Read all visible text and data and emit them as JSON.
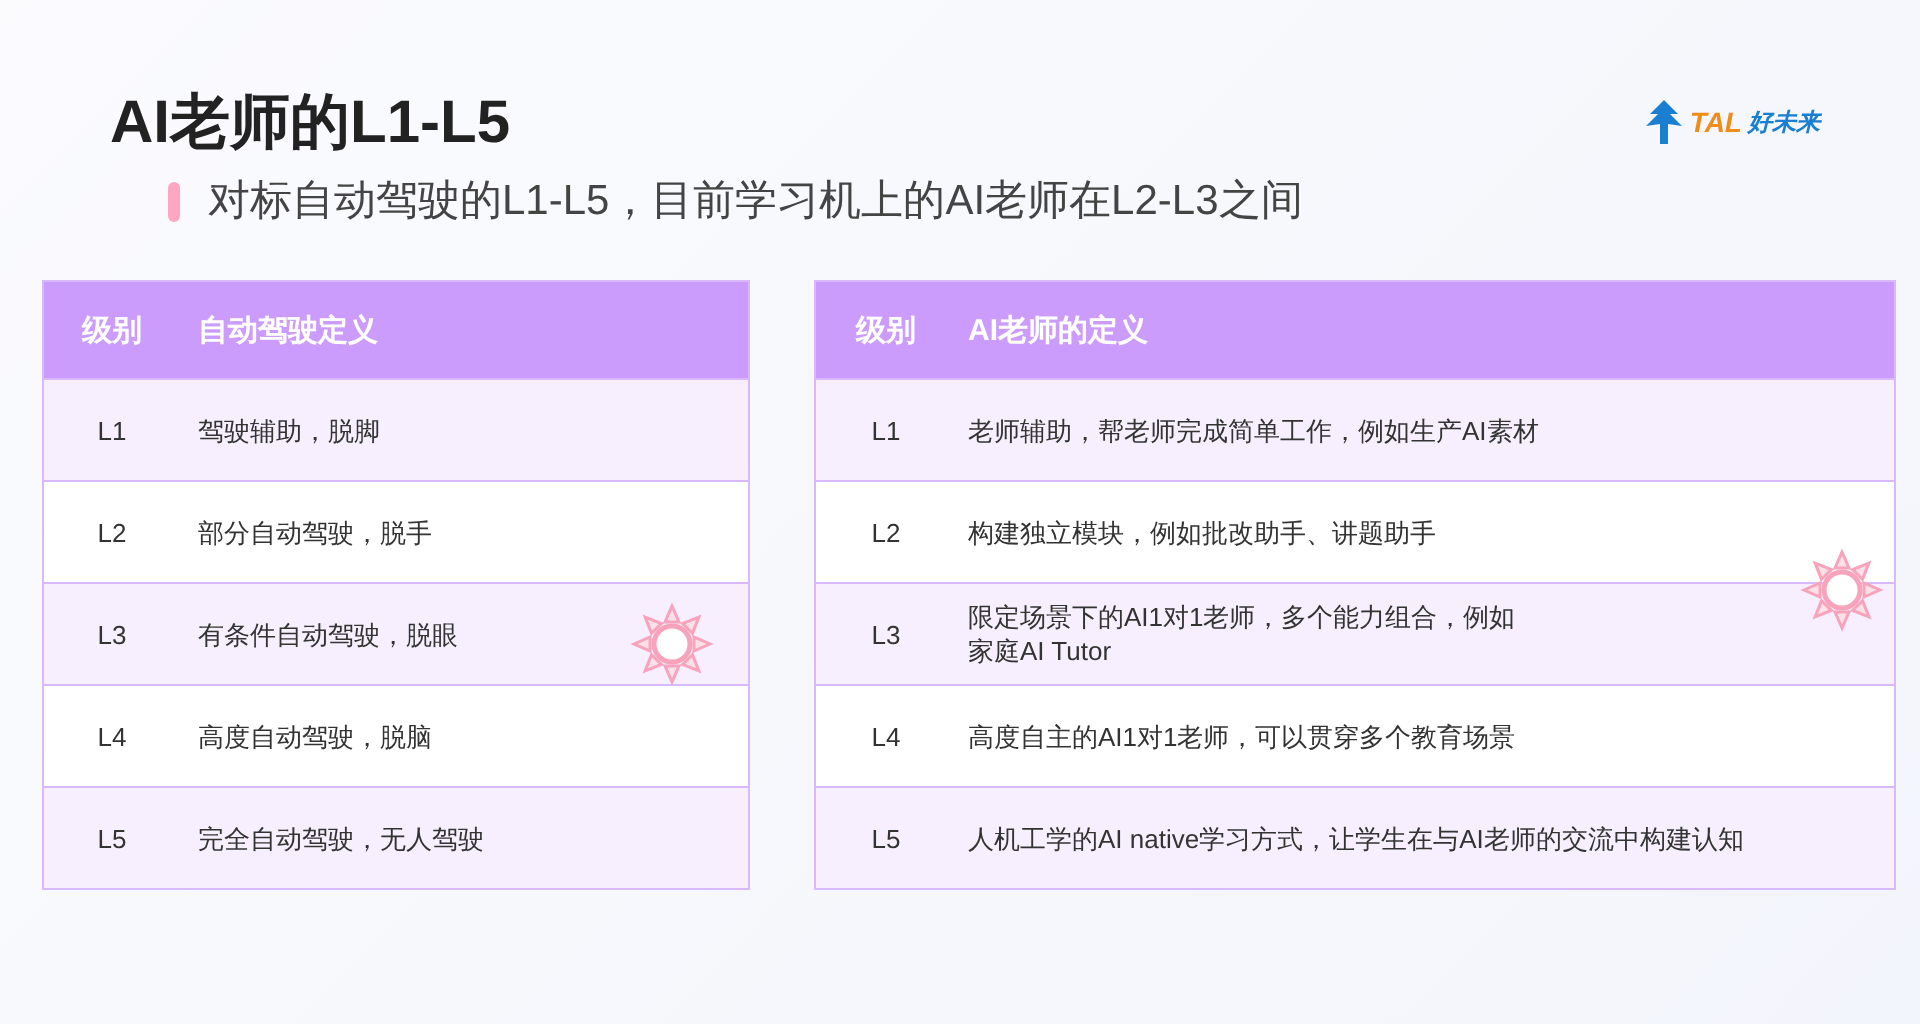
{
  "title": "AI老师的L1-L5",
  "subtitle": "对标自动驾驶的L1-L5，目前学习机上的AI老师在L2-L3之间",
  "logo": {
    "brand": "TAL",
    "chinese": "好未来"
  },
  "tables": [
    {
      "columns": [
        "级别",
        "自动驾驶定义"
      ],
      "rows": [
        [
          "L1",
          "驾驶辅助，脱脚"
        ],
        [
          "L2",
          "部分自动驾驶，脱手"
        ],
        [
          "L3",
          "有条件自动驾驶，脱眼"
        ],
        [
          "L4",
          "高度自动驾驶，脱脑"
        ],
        [
          "L5",
          "完全自动驾驶，无人驾驶"
        ]
      ]
    },
    {
      "columns": [
        "级别",
        "AI老师的定义"
      ],
      "rows": [
        [
          "L1",
          "老师辅助，帮老师完成简单工作，例如生产AI素材"
        ],
        [
          "L2",
          "构建独立模块，例如批改助手、讲题助手"
        ],
        [
          "L3",
          "限定场景下的AI1对1老师，多个能力组合，例如家庭AI Tutor"
        ],
        [
          "L4",
          "高度自主的AI1对1老师，可以贯穿多个教育场景"
        ],
        [
          "L5",
          "人机工学的AI native学习方式，让学生在与AI老师的交流中构建认知"
        ]
      ]
    }
  ]
}
